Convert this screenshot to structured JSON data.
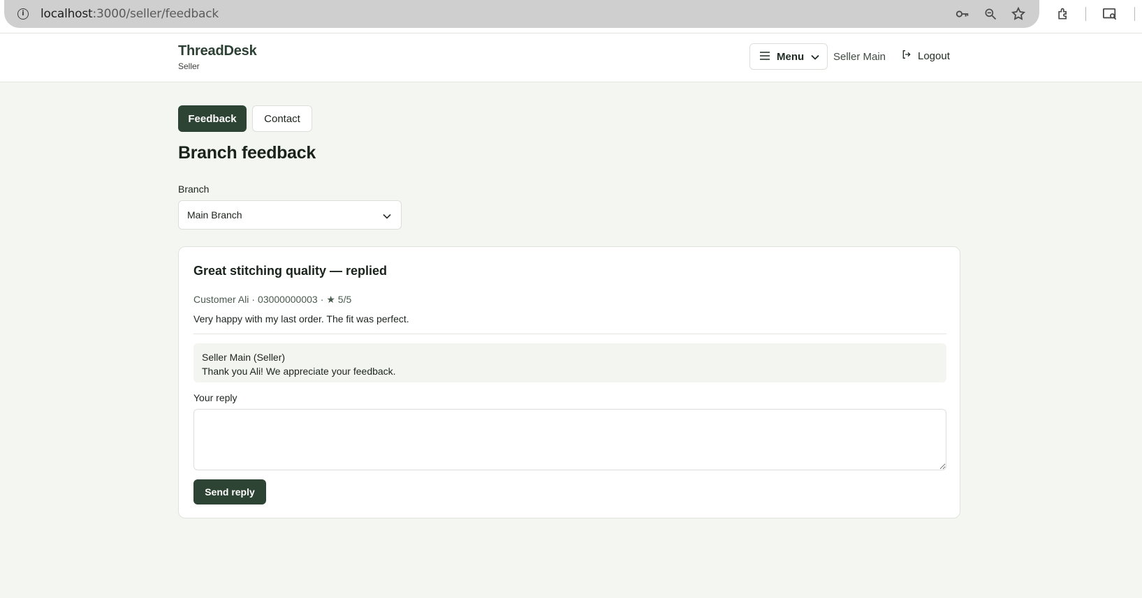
{
  "browser": {
    "url_host": "localhost",
    "url_path": ":3000/seller/feedback",
    "icons": [
      "info-icon",
      "key-icon",
      "zoom-icon",
      "star-icon",
      "extensions-icon",
      "media-search-icon"
    ]
  },
  "header": {
    "brand_title": "ThreadDesk",
    "brand_sub": "Seller",
    "menu_label": "Menu",
    "seller_name": "Seller Main",
    "logout_label": "Logout"
  },
  "tabs": [
    {
      "label": "Feedback",
      "active": true
    },
    {
      "label": "Contact",
      "active": false
    }
  ],
  "page": {
    "title": "Branch feedback",
    "branch_label": "Branch",
    "branch_value": "Main Branch"
  },
  "feedback": {
    "title": "Great stitching quality — replied",
    "customer": "Customer Ali",
    "phone": "03000000003",
    "rating": "★ 5/5",
    "separator": "·",
    "body": "Very happy with my last order. The fit was perfect.",
    "reply_author": "Seller Main (Seller)",
    "reply_text": "Thank you Ali! We appreciate your feedback.",
    "reply_label": "Your reply",
    "reply_value": "",
    "send_label": "Send reply"
  },
  "colors": {
    "accent": "#2d4334",
    "background": "#f4f6f1"
  }
}
